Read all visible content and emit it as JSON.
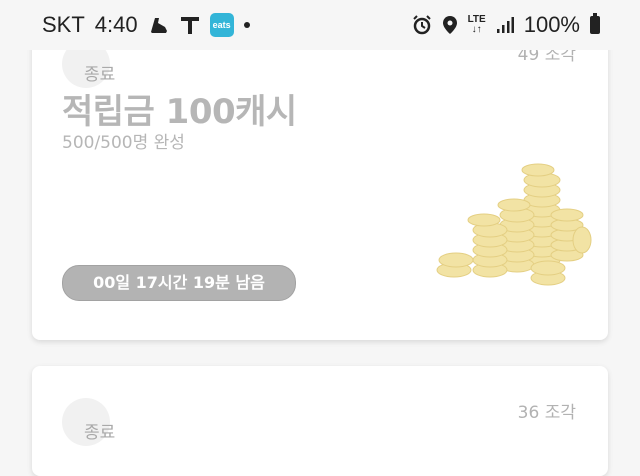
{
  "status_bar": {
    "carrier": "SKT",
    "time": "4:40",
    "eats_label": "eats",
    "network": "LTE",
    "battery": "100%"
  },
  "cards": [
    {
      "status": "종료",
      "pieces": "49 조각",
      "title": "적립금 100캐시",
      "subtitle": "500/500명 완성",
      "timer": "00일 17시간 19분 남음"
    },
    {
      "status": "종료",
      "pieces": "36 조각"
    }
  ],
  "colors": {
    "background": "#f6f6f6",
    "card": "#ffffff",
    "muted_text": "#b6b6b6",
    "timer_pill": "#b3b3b3",
    "coin": "#f2e3a4"
  },
  "icons": [
    "shoe-icon",
    "t-map-icon",
    "eats-app-icon",
    "alarm-icon",
    "location-icon",
    "signal-icon",
    "battery-icon",
    "coins-illustration"
  ]
}
